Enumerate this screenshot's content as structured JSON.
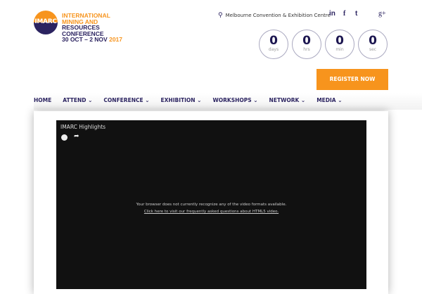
{
  "logo": {
    "circle_text": "IMARC",
    "line1": "INTERNATIONAL",
    "line2": "MINING AND",
    "line3": "RESOURCES",
    "line4": "CONFERENCE",
    "dates": "30 OCT – 2 NOV",
    "year": "2017"
  },
  "header": {
    "location": "Melbourne Convention & Exhibition Centre",
    "social": [
      "in",
      "f",
      "t",
      "g+"
    ]
  },
  "countdown": [
    {
      "value": "0",
      "unit": "days"
    },
    {
      "value": "0",
      "unit": "hrs"
    },
    {
      "value": "0",
      "unit": "min"
    },
    {
      "value": "0",
      "unit": "sec"
    }
  ],
  "register_label": "REGISTER NOW",
  "nav": [
    {
      "label": "HOME"
    },
    {
      "label": "ATTEND ⌄"
    },
    {
      "label": "CONFERENCE ⌄"
    },
    {
      "label": "EXHIBITION ⌄"
    },
    {
      "label": "WORKSHOPS ⌄"
    },
    {
      "label": "NETWORK ⌄"
    },
    {
      "label": "MEDIA ⌄"
    }
  ],
  "video": {
    "title": "IMARC Highlights",
    "message": "Your browser does not currently recognize any of the video formats available.",
    "link": "Click here to visit our frequently asked questions about HTML5 video."
  },
  "colors": {
    "orange": "#f7941d",
    "navy": "#2b2360"
  }
}
